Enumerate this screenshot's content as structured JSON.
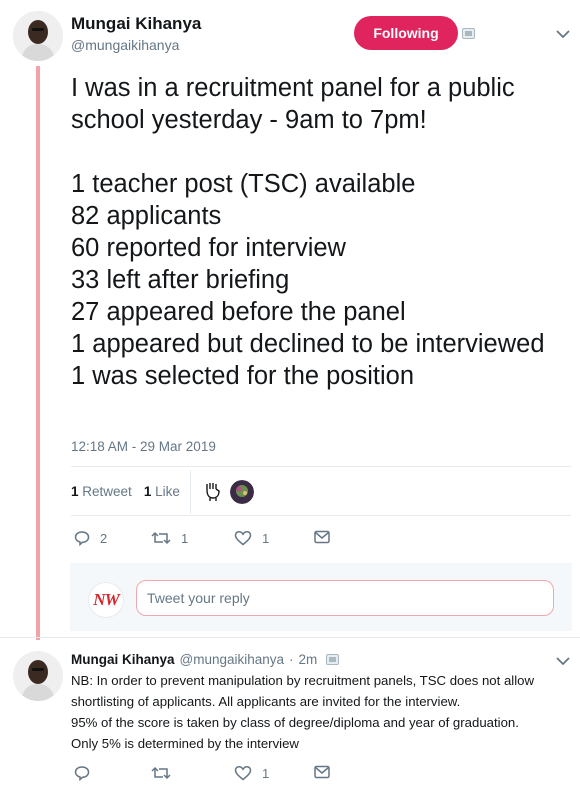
{
  "tweet": {
    "author_name": "Mungai Kihanya",
    "author_handle": "@mungaikihanya",
    "follow_label": "Following",
    "text": "I was in a recruitment panel for a public school yesterday - 9am to 7pm!\n\n1 teacher post (TSC) available\n82 applicants\n60 reported for interview\n33 left after briefing\n27 appeared before the panel\n1 appeared but declined to be interviewed\n1 was selected for the position",
    "timestamp": "12:18 AM - 29 Mar 2019",
    "retweet_count": "1",
    "retweet_label": "Retweet",
    "like_count": "1",
    "like_label": "Like",
    "actions": {
      "reply_count": "2",
      "retweet_count": "1",
      "like_count": "1"
    }
  },
  "reply_composer": {
    "avatar_text": "NW",
    "placeholder": "Tweet your reply"
  },
  "reply_tweet": {
    "author_name": "Mungai Kihanya",
    "author_handle": "@mungaikihanya",
    "separator": "·",
    "time": "2m",
    "lines": [
      "NB: In order to prevent manipulation by recruitment panels, TSC does not allow shortlisting of applicants. All applicants are invited for the interview.",
      "95% of the score is taken by class of degree/diploma and year of graduation.",
      "Only 5% is determined by the interview"
    ],
    "actions": {
      "like_count": "1"
    }
  },
  "colors": {
    "following_button": "#e0245e",
    "thread_line": "#f3a3a8",
    "secondary_text": "#657786",
    "divider": "#e6ecf0"
  }
}
